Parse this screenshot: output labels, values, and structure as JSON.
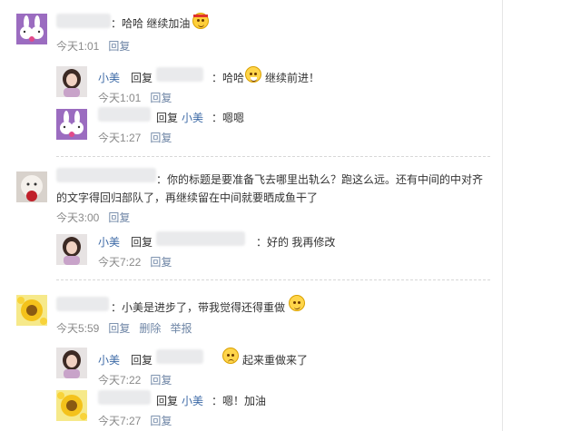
{
  "colors": {
    "link": "#6f86a6",
    "name": "#3d6aa6",
    "meta": "#8a8a8a",
    "divider": "#d7d7d7"
  },
  "comments": [
    {
      "text": "：哈哈 继续加油",
      "time": "今天1:01",
      "reply_label": "回复",
      "emoticon": "headband-face-icon",
      "replies": [
        {
          "name": "小美",
          "reply_word": "回复",
          "text": "：哈哈",
          "text2": "继续前进！",
          "emoticon": "grin-icon",
          "time": "今天1:01",
          "reply_label": "回复"
        },
        {
          "reply_word": "回复",
          "target": "小美",
          "text": "：嗯嗯",
          "time": "今天1:27",
          "reply_label": "回复"
        }
      ]
    },
    {
      "text": "：你的标题是要准备飞去哪里出轨么？跑这么远。还有中间的中对齐",
      "text_line2": "的文字得回归部队了，再继续留在中间就要晒成鱼干了",
      "time": "今天3:00",
      "reply_label": "回复",
      "replies": [
        {
          "name": "小美",
          "reply_word": "回复",
          "text": "：好的 我再修改",
          "time": "今天7:22",
          "reply_label": "回复"
        }
      ]
    },
    {
      "text": "：小美是进步了，带我觉得还得重做",
      "emoticon": "thinking-face-icon",
      "time": "今天5:59",
      "reply_label": "回复",
      "delete_label": "删除",
      "report_label": "举报",
      "replies": [
        {
          "name": "小美",
          "reply_word": "回复",
          "text": "起来重做来了",
          "emoticon": "sweat-face-icon",
          "time": "今天7:22",
          "reply_label": "回复"
        },
        {
          "reply_word": "回复",
          "target": "小美",
          "text": "：嗯！加油",
          "time": "今天7:27",
          "reply_label": "回复"
        }
      ]
    }
  ]
}
